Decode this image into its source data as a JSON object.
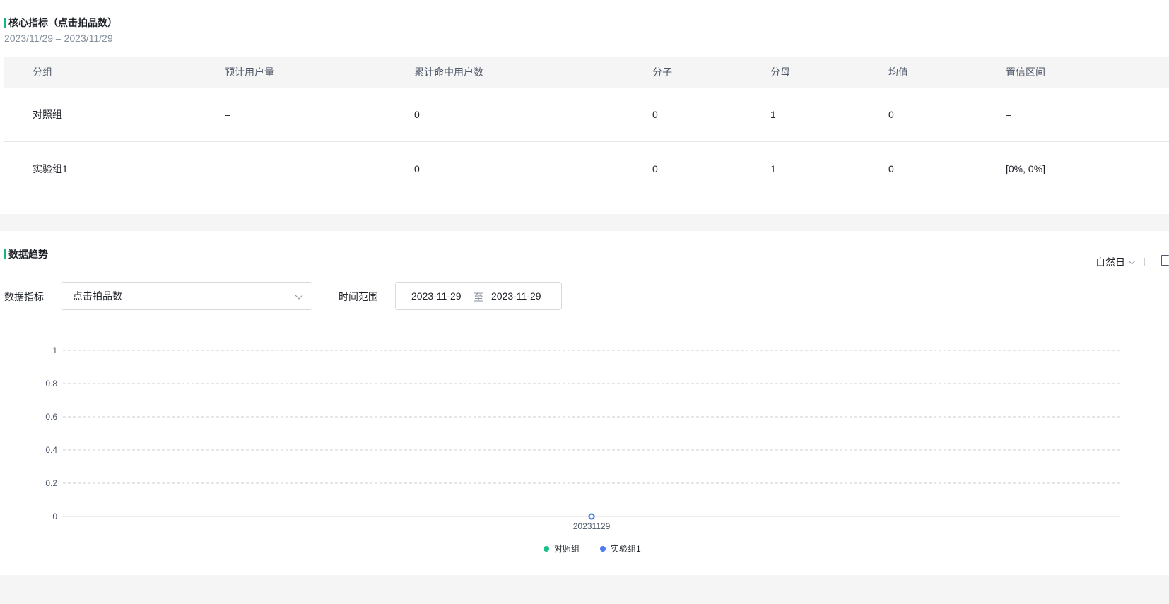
{
  "core_metrics": {
    "title": "核心指标（点击拍品数）",
    "date_range": "2023/11/29 – 2023/11/29",
    "columns": [
      "分组",
      "预计用户量",
      "累计命中用户数",
      "分子",
      "分母",
      "均值",
      "置信区间"
    ],
    "rows": [
      [
        "对照组",
        "–",
        "0",
        "0",
        "1",
        "0",
        "–"
      ],
      [
        "实验组1",
        "–",
        "0",
        "0",
        "1",
        "0",
        "[0%, 0%]"
      ]
    ]
  },
  "trend": {
    "title": "数据趋势",
    "granularity": "自然日",
    "metric_label": "数据指标",
    "metric_value": "点击拍品数",
    "range_label": "时间范围",
    "range_start": "2023-11-29",
    "range_to": "至",
    "range_end": "2023-11-29"
  },
  "colors": {
    "accent": "#16b680",
    "control": "#18c08a",
    "experiment": "#4f7cf0",
    "grid": "#c9cdd4"
  },
  "chart_data": {
    "type": "line",
    "x": [
      "20231129"
    ],
    "y_ticks": [
      "1",
      "0.8",
      "0.6",
      "0.4",
      "0.2",
      "0"
    ],
    "ylim": [
      0,
      1
    ],
    "series": [
      {
        "name": "对照组",
        "values": [
          0
        ]
      },
      {
        "name": "实验组1",
        "values": [
          0
        ]
      }
    ],
    "legend": [
      "对照组",
      "实验组1"
    ],
    "legend_position": "bottom-center",
    "grid": true
  }
}
